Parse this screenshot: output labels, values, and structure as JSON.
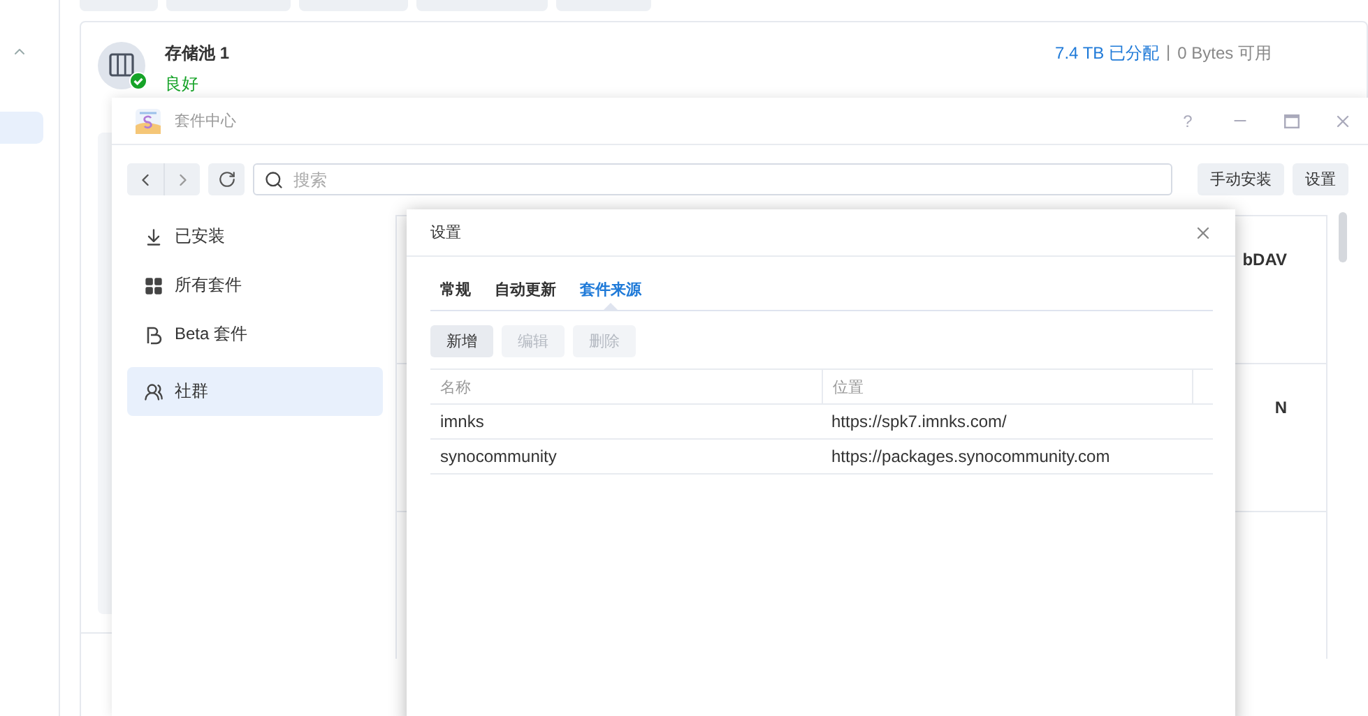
{
  "sidebar": {
    "items": [
      {
        "selected": true
      }
    ]
  },
  "top_buttons": [
    {
      "kind": "button"
    },
    {
      "kind": "button"
    },
    {
      "kind": "button"
    },
    {
      "kind": "button"
    },
    {
      "kind": "button"
    }
  ],
  "pool": {
    "name": "存储池 1",
    "status": "良好",
    "allocated": "7.4 TB 已分配",
    "separator": "|",
    "available": "0 Bytes 可用"
  },
  "package_center": {
    "title": "套件中心",
    "help": "?",
    "search": {
      "placeholder": "搜索"
    },
    "buttons": [
      "手动安装",
      "设置"
    ],
    "nav": [
      {
        "label": "已安装",
        "kind": "download",
        "selected": false
      },
      {
        "label": "所有套件",
        "kind": "grid",
        "selected": false
      },
      {
        "label": "Beta 套件",
        "kind": "beta",
        "selected": false
      },
      {
        "label": "社群",
        "kind": "community",
        "selected": true
      }
    ],
    "cards": [
      {
        "title": "bDAV"
      },
      {
        "title": "N"
      }
    ]
  },
  "settings_dialog": {
    "title": "设置",
    "tabs": [
      {
        "label": "常规",
        "selected": false
      },
      {
        "label": "自动更新",
        "selected": false
      },
      {
        "label": "套件来源",
        "selected": true
      }
    ],
    "buttons": [
      {
        "label": "新增",
        "disabled": false
      },
      {
        "label": "编辑",
        "disabled": true
      },
      {
        "label": "删除",
        "disabled": true
      }
    ],
    "columns": [
      "名称",
      "位置"
    ],
    "rows": [
      {
        "name": "imnks",
        "location": "https://spk7.imnks.com/"
      },
      {
        "name": "synocommunity",
        "location": "https://packages.synocommunity.com"
      }
    ]
  }
}
